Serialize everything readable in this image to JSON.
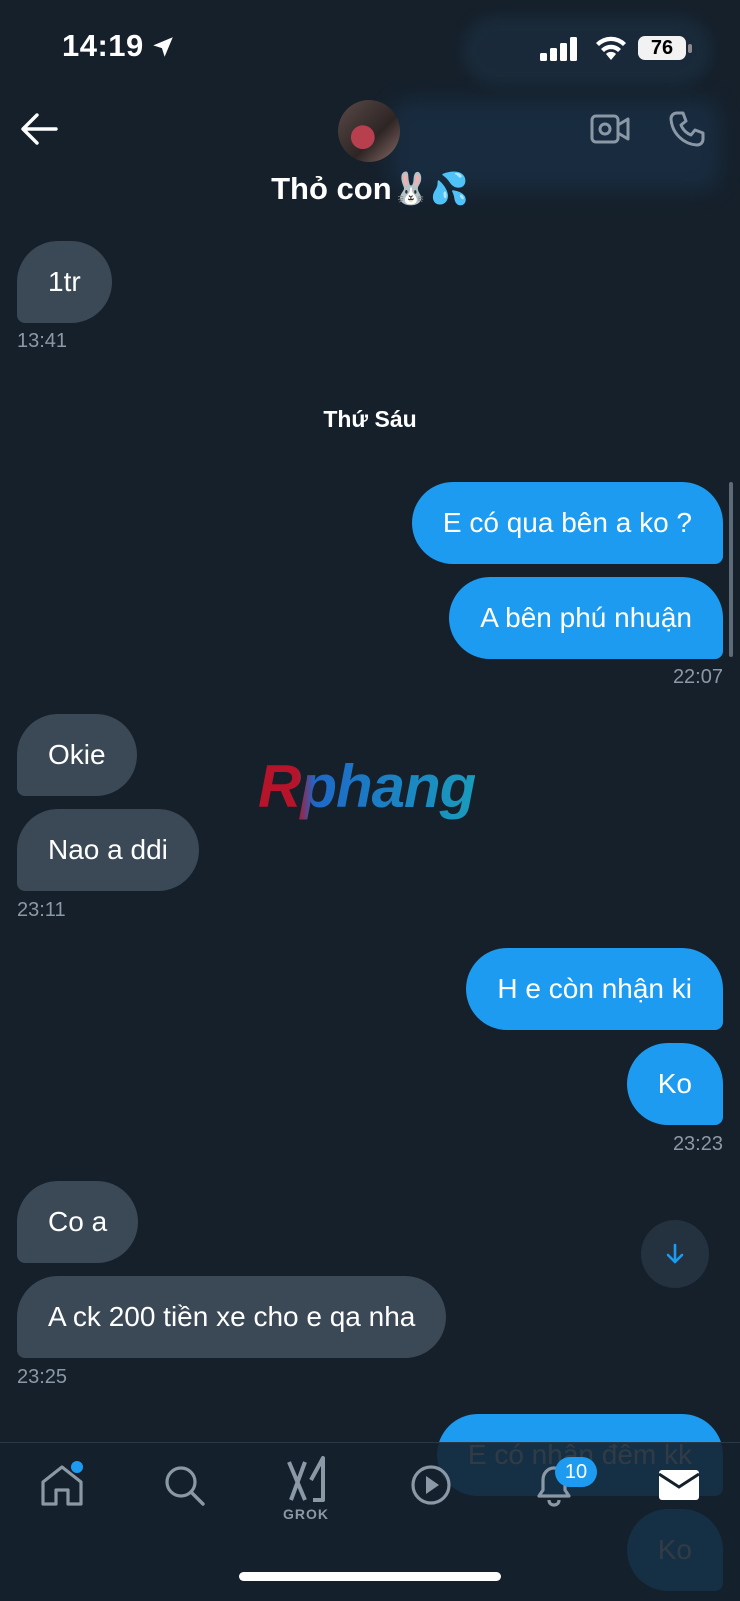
{
  "status_bar": {
    "time": "14:19",
    "battery": "76"
  },
  "header": {
    "contact_name": "Thỏ con🐰💦"
  },
  "day_separator": "Thứ Sáu",
  "watermark": "Rphang",
  "messages": [
    {
      "text": "1tr",
      "direction": "in"
    },
    {
      "text": "E có qua bên a ko ?",
      "direction": "out"
    },
    {
      "text": "A bên phú nhuận",
      "direction": "out"
    },
    {
      "text": "Okie",
      "direction": "in"
    },
    {
      "text": "Nao a ddi",
      "direction": "in"
    },
    {
      "text": "H e còn nhận ki",
      "direction": "out"
    },
    {
      "text": "Ko",
      "direction": "out"
    },
    {
      "text": "Co a",
      "direction": "in"
    },
    {
      "text": "A ck 200 tiền xe cho e qa nha",
      "direction": "in"
    },
    {
      "text": "E có nhận đêm kk",
      "direction": "out"
    },
    {
      "text": "Ko",
      "direction": "out"
    }
  ],
  "timestamps": [
    "13:41",
    "22:07",
    "23:11",
    "23:23",
    "23:25"
  ],
  "nav": {
    "items": [
      "home-icon",
      "search-icon",
      "grok-icon",
      "video-play-icon",
      "bell-icon",
      "mail-icon"
    ],
    "grok_label": "GROK",
    "notifications_count": "10"
  },
  "colors": {
    "background": "#15202b",
    "outgoing_bubble": "#1d9bf0",
    "incoming_bubble": "#3b4957",
    "accent": "#1d9bf0"
  }
}
